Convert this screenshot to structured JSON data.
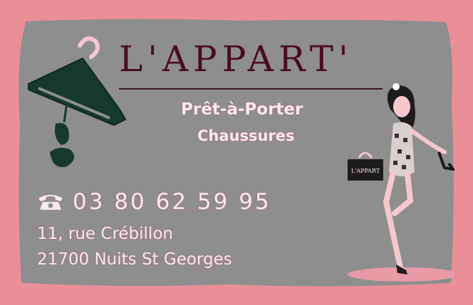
{
  "card": {
    "brand": "L'APPART'",
    "line1": "Prêt-à-Porter",
    "line2": "Chaussures",
    "phone": "03 80 62 59 95",
    "address_line1": "11, rue Crébillon",
    "address_line2": "21700 Nuits St Georges",
    "bag_label": "L'APPART",
    "icons": [
      "hanger-icon",
      "telephone-icon",
      "boots-icon",
      "woman-illustration"
    ]
  },
  "colors": {
    "background": "#ea8f98",
    "card": "#8e8e8e",
    "brand_text": "#4a0d1c",
    "light_text": "#fde8ee"
  }
}
